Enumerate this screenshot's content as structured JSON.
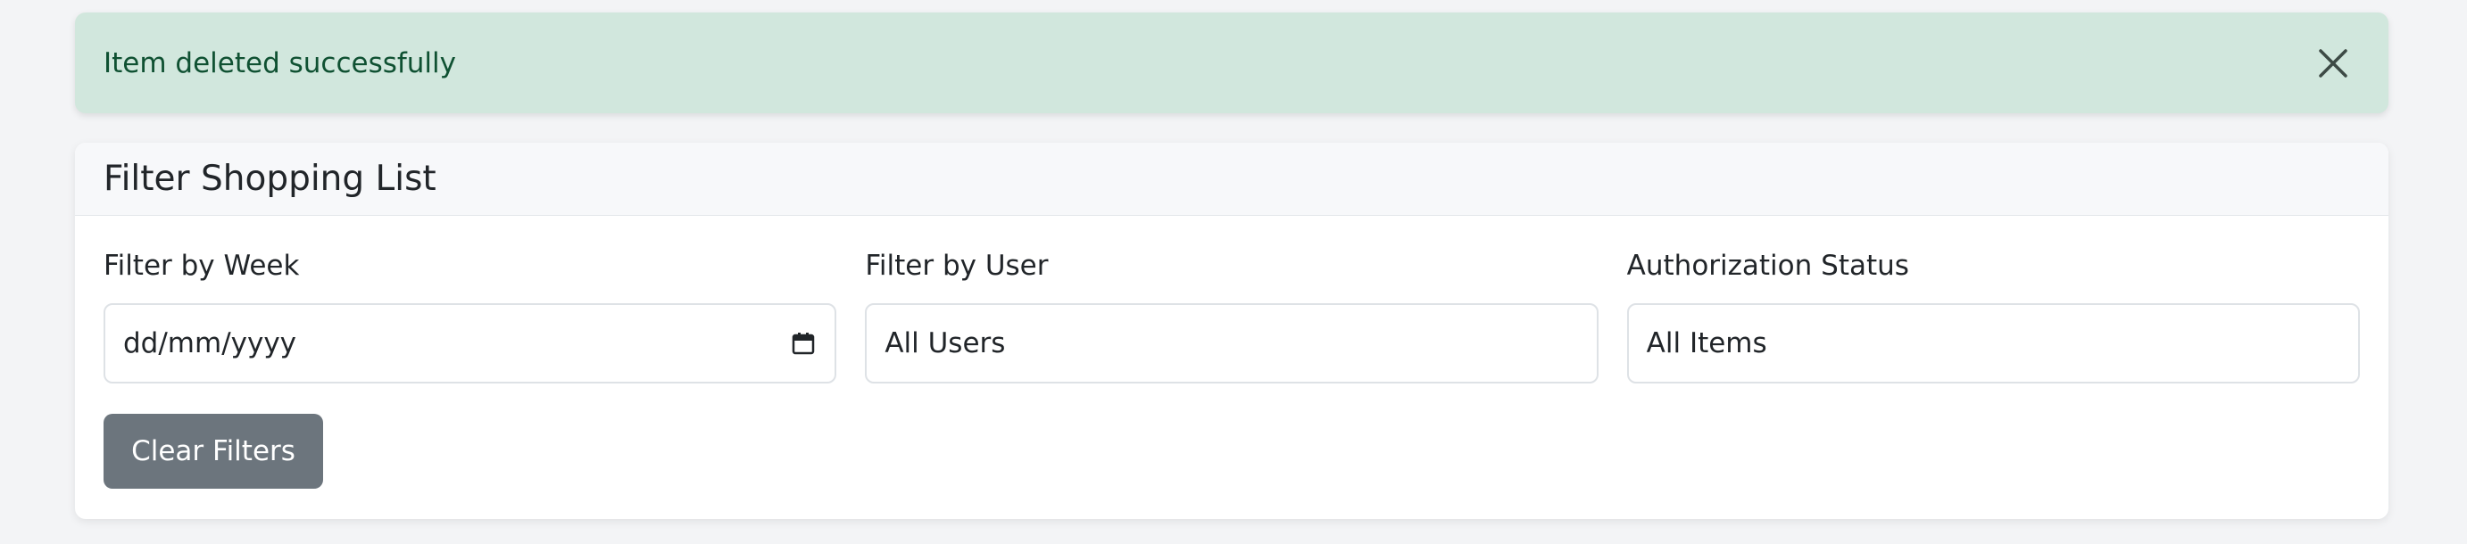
{
  "alert": {
    "message": "Item deleted successfully",
    "close_icon": "close-icon",
    "background": "#d1e7dd",
    "text_color": "#0f5132"
  },
  "card": {
    "title": "Filter Shopping List"
  },
  "filters": {
    "week": {
      "label": "Filter by Week",
      "value": "dd/mm/yyyy",
      "icon": "calendar-icon"
    },
    "user": {
      "label": "Filter by User",
      "value": "All Users"
    },
    "status": {
      "label": "Authorization Status",
      "value": "All Items"
    }
  },
  "actions": {
    "clear_label": "Clear Filters",
    "clear_color": "#6c757d"
  }
}
